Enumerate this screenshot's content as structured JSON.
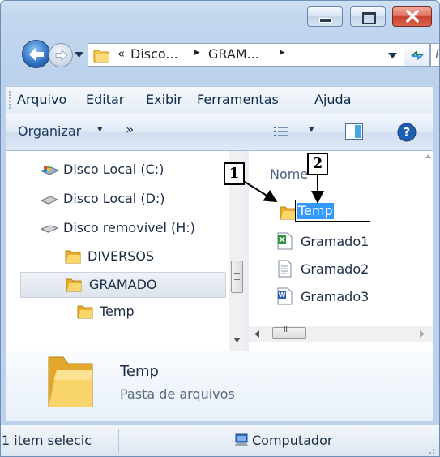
{
  "window": {
    "controls": [
      "minimize",
      "maximize",
      "close"
    ]
  },
  "address_bar": {
    "overflow_glyph": "«",
    "segments": [
      "Disco...",
      "GRAM..."
    ],
    "separator": "▸",
    "search_placeholder": "P"
  },
  "menu": {
    "items": [
      "Arquivo",
      "Editar",
      "Exibir",
      "Ferramentas",
      "Ajuda"
    ]
  },
  "toolbar": {
    "organize_label": "Organizar",
    "organize_arrow": "▾",
    "more_label": "»",
    "view_arrow": "▾"
  },
  "navigation": {
    "items": [
      {
        "label": "Disco Local (C:)",
        "icon": "system-drive-icon"
      },
      {
        "label": "Disco Local (D:)",
        "icon": "hard-drive-icon"
      },
      {
        "label": "Disco removível (H:)",
        "icon": "removable-drive-icon"
      },
      {
        "label": "DIVERSOS",
        "icon": "folder-icon"
      },
      {
        "label": "GRAMADO",
        "icon": "folder-icon",
        "selected": true
      },
      {
        "label": "Temp",
        "icon": "folder-icon"
      }
    ]
  },
  "file_list": {
    "column_header": "Nome",
    "items": [
      {
        "label": "Temp",
        "icon": "folder-icon",
        "renaming": true
      },
      {
        "label": "Gramado1",
        "icon": "spreadsheet-document-icon"
      },
      {
        "label": "Gramado2",
        "icon": "text-document-icon"
      },
      {
        "label": "Gramado3",
        "icon": "word-document-icon"
      }
    ],
    "scrollbar_thumb_glyph": "III"
  },
  "details": {
    "name": "Temp",
    "type": "Pasta de arquivos"
  },
  "status": {
    "selection_text": "1 item selecic",
    "location": "Computador"
  },
  "annotations": {
    "callout_1": "1",
    "callout_2": "2"
  },
  "colors": {
    "selection_blue": "#3399ff",
    "close_red": "#c8412c",
    "folder_yellow": "#f5c44a",
    "link_blue": "#1e395b"
  }
}
